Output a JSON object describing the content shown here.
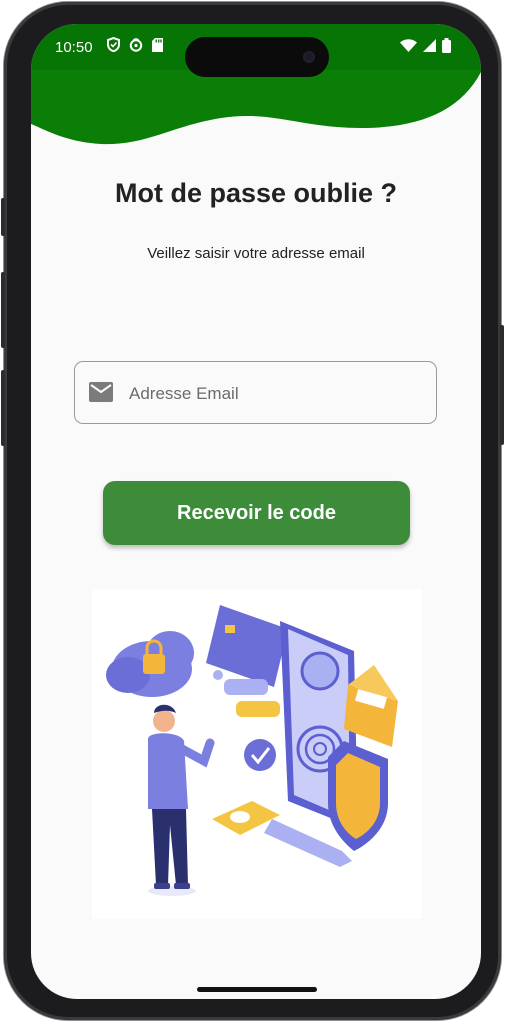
{
  "status_bar": {
    "time": "10:50"
  },
  "screen": {
    "title": "Mot de passe oublie ?",
    "subtitle": "Veillez saisir votre adresse email"
  },
  "email_field": {
    "placeholder": "Adresse Email",
    "value": ""
  },
  "submit_button": {
    "label": "Recevoir le code"
  },
  "colors": {
    "header_green": "#0a7e07",
    "button_green": "#3d8c3a",
    "background": "#fafafa",
    "text": "#222222"
  },
  "icons": {
    "email_field": "mail-icon",
    "status_left": [
      "shield-icon",
      "sync-icon",
      "sdcard-icon"
    ],
    "status_right": [
      "wifi-icon",
      "signal-icon",
      "battery-icon"
    ]
  },
  "illustration": {
    "subject": "security-verification-illustration"
  }
}
